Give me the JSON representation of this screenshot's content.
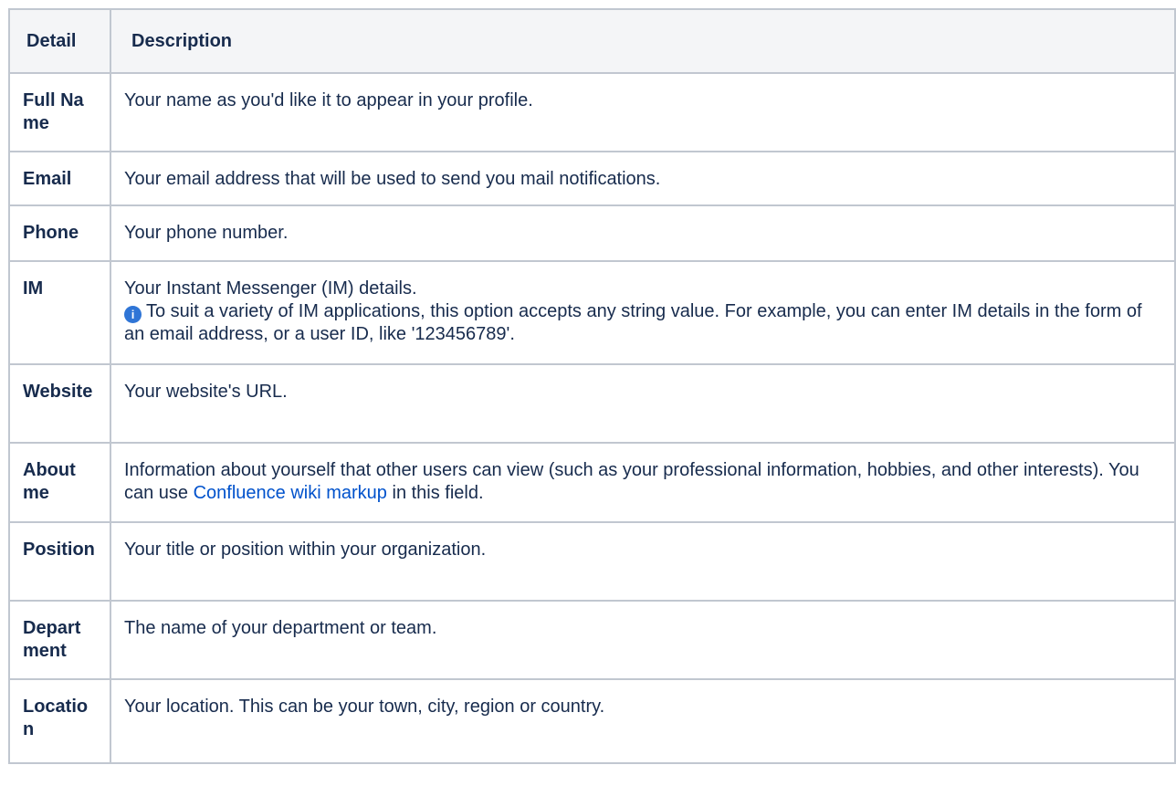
{
  "table": {
    "headers": {
      "detail": "Detail",
      "description": "Description"
    },
    "rows": [
      {
        "detail": "Full Name",
        "description": "Your name as you'd like it to appear in your profile."
      },
      {
        "detail": "Email",
        "description": "Your email address that will be used to send you mail notifications."
      },
      {
        "detail": "Phone",
        "description": "Your phone number."
      },
      {
        "detail": "IM",
        "description": "Your Instant Messenger (IM) details.",
        "note": "To suit a variety of IM applications, this option accepts any string value. For example, you can enter IM details in the form of an email address, or a user ID, like '123456789'.",
        "note_icon": "info-icon"
      },
      {
        "detail": "Website",
        "description": "Your website's URL."
      },
      {
        "detail": "About me",
        "description_before_link": "Information about yourself that other users can view (such as your professional information, hobbies, and other interests). You can use ",
        "link_text": "Confluence wiki markup",
        "description_after_link": " in this field."
      },
      {
        "detail": "Position",
        "description": "Your title or position within your organization."
      },
      {
        "detail": "Department",
        "description": "The name of your department or team."
      },
      {
        "detail": "Location",
        "description": "Your location. This can be your town, city, region or country."
      }
    ]
  },
  "colors": {
    "border": "#c1c7d0",
    "header_bg": "#f4f5f7",
    "text": "#172b4d",
    "link": "#0052cc",
    "info_icon": "#2f75d6"
  }
}
